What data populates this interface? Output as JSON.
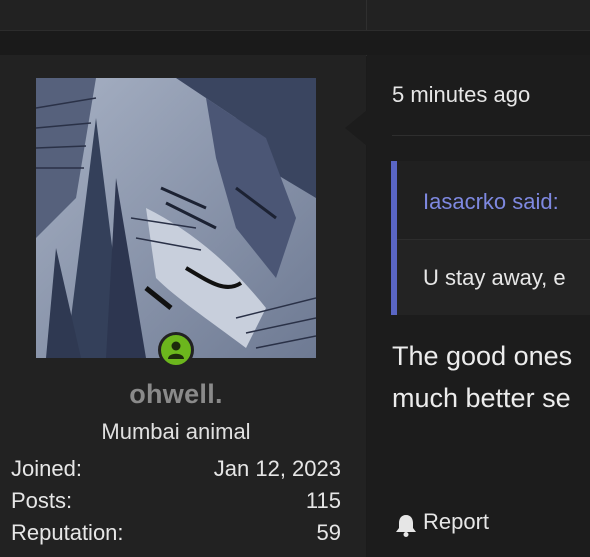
{
  "user": {
    "username": "ohwell.",
    "title": "Mumbai animal",
    "online": true,
    "stats": [
      {
        "label": "Joined:",
        "value": "Jan 12, 2023"
      },
      {
        "label": "Posts:",
        "value": "115"
      },
      {
        "label": "Reputation:",
        "value": "59"
      }
    ]
  },
  "post": {
    "time": "5 minutes ago",
    "quote": {
      "author": "Iasacrko said:",
      "text": "U stay away, e"
    },
    "body_lines": [
      "The good ones",
      "much better se"
    ],
    "actions": {
      "report_label": "Report"
    }
  },
  "colors": {
    "username": "#8a8a8a",
    "quote_border": "#5a66c4",
    "quote_author": "#7e88e0",
    "online_badge": "#6cb61d"
  },
  "icons": {
    "online": "user-online-icon",
    "report": "bell-icon"
  }
}
